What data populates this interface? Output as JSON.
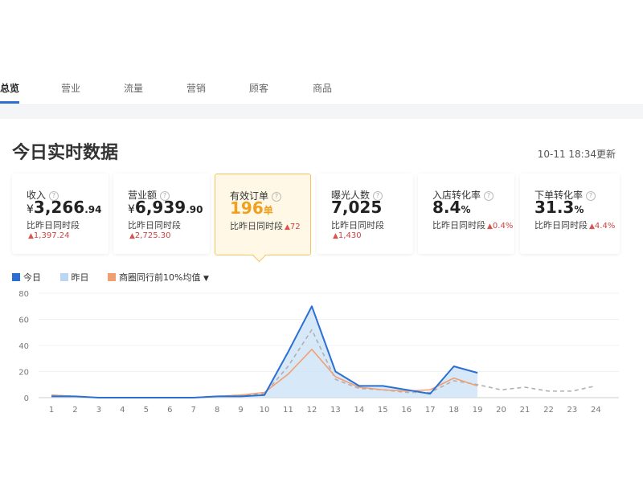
{
  "tabs": [
    {
      "label": "总览",
      "active": true
    },
    {
      "label": "营业",
      "active": false
    },
    {
      "label": "流量",
      "active": false
    },
    {
      "label": "营销",
      "active": false
    },
    {
      "label": "顾客",
      "active": false
    },
    {
      "label": "商品",
      "active": false
    }
  ],
  "header": {
    "title": "今日实时数据",
    "update_time": "10-11 18:34更新"
  },
  "metrics": [
    {
      "label": "收入",
      "currency": "¥",
      "int": "3,266",
      "dec": ".94",
      "unit": "",
      "compare_label": "比昨日同时段",
      "delta": "1,397.24"
    },
    {
      "label": "营业额",
      "currency": "¥",
      "int": "6,939",
      "dec": ".90",
      "unit": "",
      "compare_label": "比昨日同时段",
      "delta": "2,725.30"
    },
    {
      "label": "有效订单",
      "currency": "",
      "int": "196",
      "dec": "",
      "unit": "单",
      "compare_label": "比昨日同时段",
      "delta": "72"
    },
    {
      "label": "曝光人数",
      "currency": "",
      "int": "7,025",
      "dec": "",
      "unit": "",
      "compare_label": "比昨日同时段",
      "delta": "1,430"
    },
    {
      "label": "入店转化率",
      "currency": "",
      "int": "8.4",
      "dec": "",
      "unit": "%",
      "compare_label": "比昨日同时段",
      "delta": "0.4%"
    },
    {
      "label": "下单转化率",
      "currency": "",
      "int": "31.3",
      "dec": "",
      "unit": "%",
      "compare_label": "比昨日同时段",
      "delta": "4.4%"
    }
  ],
  "legend": [
    {
      "label": "今日",
      "color": "#2b6fd4"
    },
    {
      "label": "昨日",
      "color": "#b9d6f2"
    },
    {
      "label": "商圈同行前10%均值",
      "color": "#f0a070"
    }
  ],
  "icons": {
    "help": "question-circle-icon",
    "up": "arrow-up-icon",
    "dropdown": "chevron-down-icon"
  },
  "chart_data": {
    "type": "line",
    "x": [
      1,
      2,
      3,
      4,
      5,
      6,
      7,
      8,
      9,
      10,
      11,
      12,
      13,
      14,
      15,
      16,
      17,
      18,
      19,
      20,
      21,
      22,
      23,
      24
    ],
    "ylim": [
      0,
      80
    ],
    "yticks": [
      0,
      20,
      40,
      60,
      80
    ],
    "series": [
      {
        "name": "今日",
        "color": "#2b6fd4",
        "values": [
          1,
          1,
          0,
          0,
          0,
          0,
          0,
          1,
          1,
          2,
          35,
          70,
          20,
          9,
          9,
          6,
          3,
          24,
          19,
          null,
          null,
          null,
          null,
          null
        ]
      },
      {
        "name": "昨日",
        "color": "#b0b0b0",
        "style": "dashed",
        "values": [
          2,
          1,
          0,
          0,
          0,
          0,
          0,
          1,
          2,
          3,
          24,
          52,
          14,
          7,
          6,
          4,
          4,
          13,
          10,
          6,
          8,
          5,
          5,
          9
        ]
      },
      {
        "name": "商圈同行前10%均值",
        "color": "#f0a070",
        "values": [
          2,
          1,
          0,
          0,
          0,
          0,
          0,
          1,
          2,
          4,
          18,
          37,
          16,
          8,
          6,
          5,
          6,
          15,
          9,
          null,
          null,
          null,
          null,
          null
        ]
      }
    ]
  }
}
